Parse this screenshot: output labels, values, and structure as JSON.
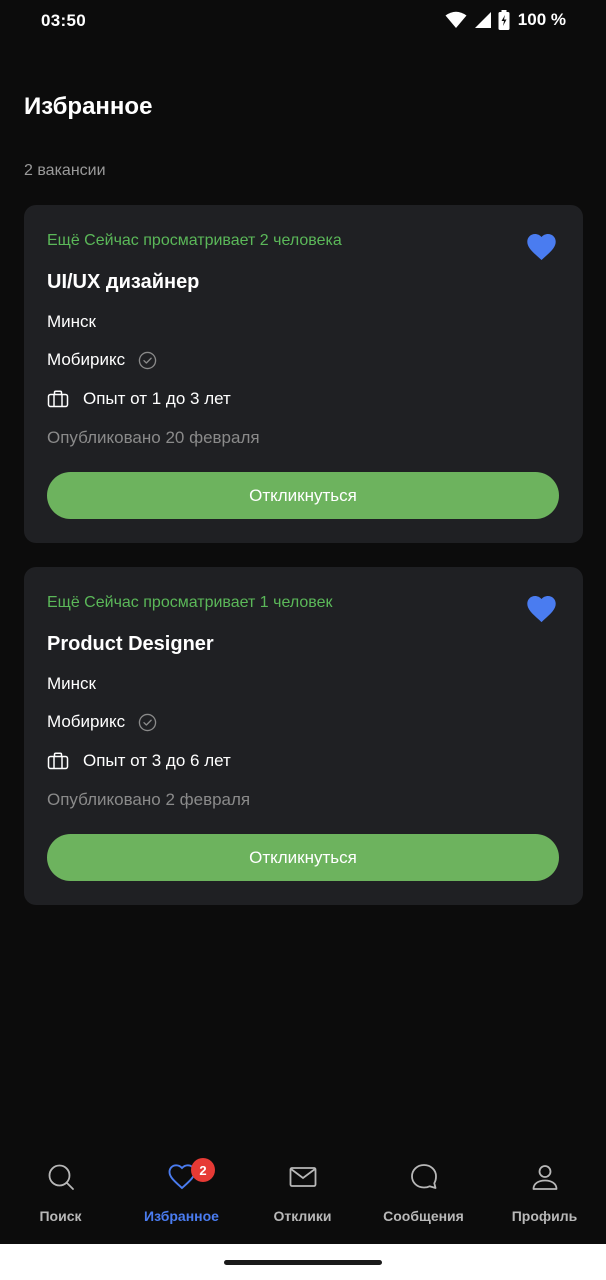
{
  "status": {
    "time": "03:50",
    "battery": "100 %"
  },
  "page": {
    "title": "Избранное",
    "count": "2 вакансии"
  },
  "vacancies": [
    {
      "views": "Ещё Сейчас просматривает 2 человека",
      "title": "UI/UX дизайнер",
      "city": "Минск",
      "company": "Мобирикс",
      "experience": "Опыт от 1 до 3 лет",
      "published": "Опубликовано 20 февраля",
      "button": "Откликнуться"
    },
    {
      "views": "Ещё Сейчас просматривает 1 человек",
      "title": "Product Designer",
      "city": "Минск",
      "company": "Мобирикс",
      "experience": "Опыт от 3 до 6 лет",
      "published": "Опубликовано 2 февраля",
      "button": "Откликнуться"
    }
  ],
  "nav": {
    "items": [
      {
        "label": "Поиск",
        "icon": "search-icon"
      },
      {
        "label": "Избранное",
        "icon": "heart-icon",
        "badge": "2"
      },
      {
        "label": "Отклики",
        "icon": "mail-icon"
      },
      {
        "label": "Сообщения",
        "icon": "chat-icon"
      },
      {
        "label": "Профиль",
        "icon": "person-icon"
      }
    ]
  },
  "colors": {
    "accent": "#4a7cf0",
    "green": "#6db35e",
    "badge": "#e63a35"
  }
}
